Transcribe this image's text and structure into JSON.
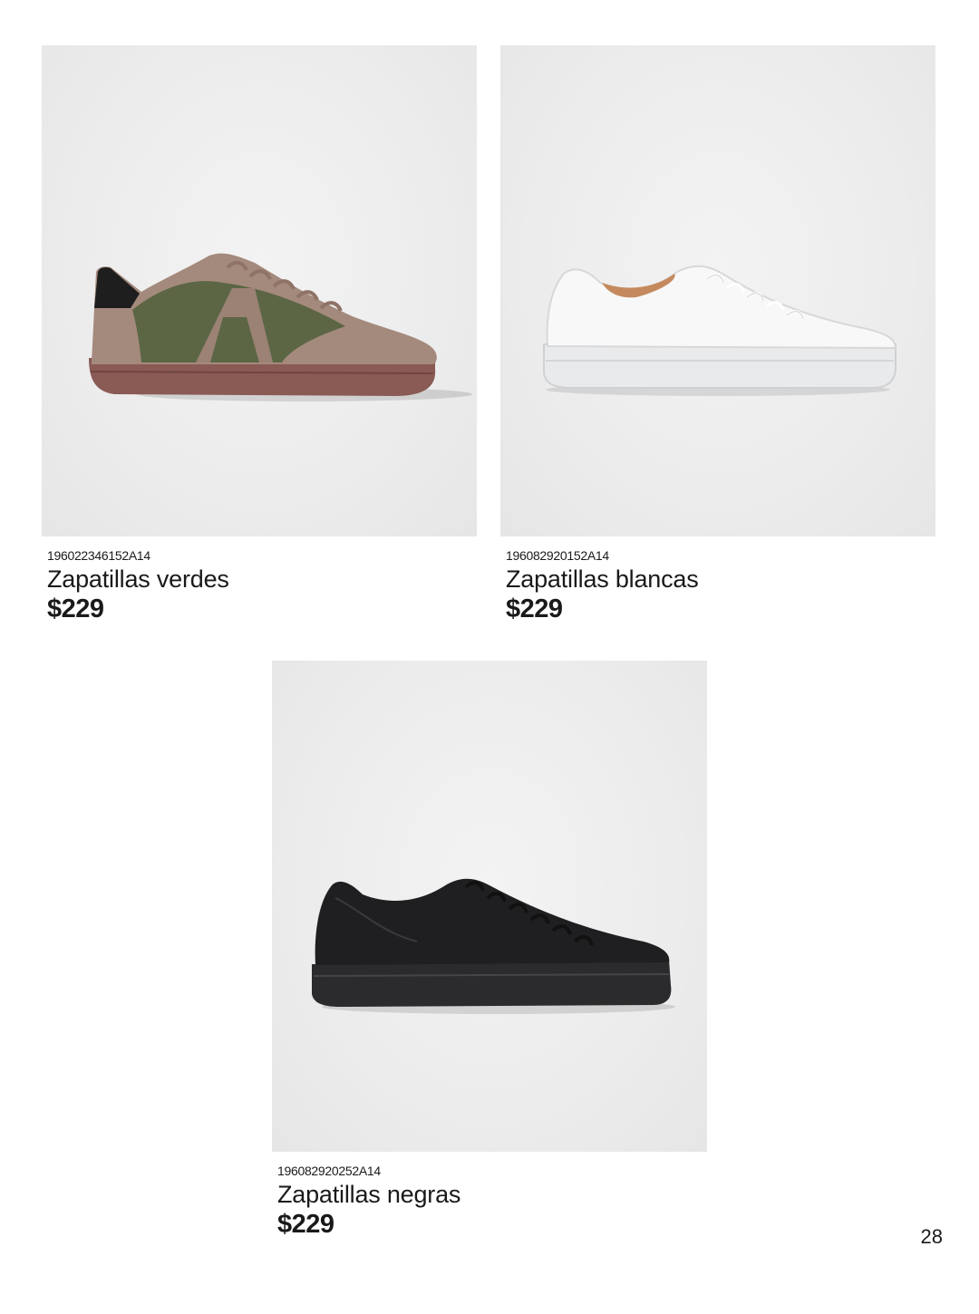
{
  "products": [
    {
      "sku": "196022346152A14",
      "name": "Zapatillas verdes",
      "price": "$229",
      "image": "green-suede-sneaker"
    },
    {
      "sku": "196082920152A14",
      "name": "Zapatillas blancas",
      "price": "$229",
      "image": "white-leather-sneaker"
    },
    {
      "sku": "196082920252A14",
      "name": "Zapatillas negras",
      "price": "$229",
      "image": "black-leather-sneaker"
    }
  ],
  "page_number": "28",
  "colors": {
    "background": "#ffffff",
    "photo_bg": "#ececec",
    "text": "#1a1a1a"
  }
}
